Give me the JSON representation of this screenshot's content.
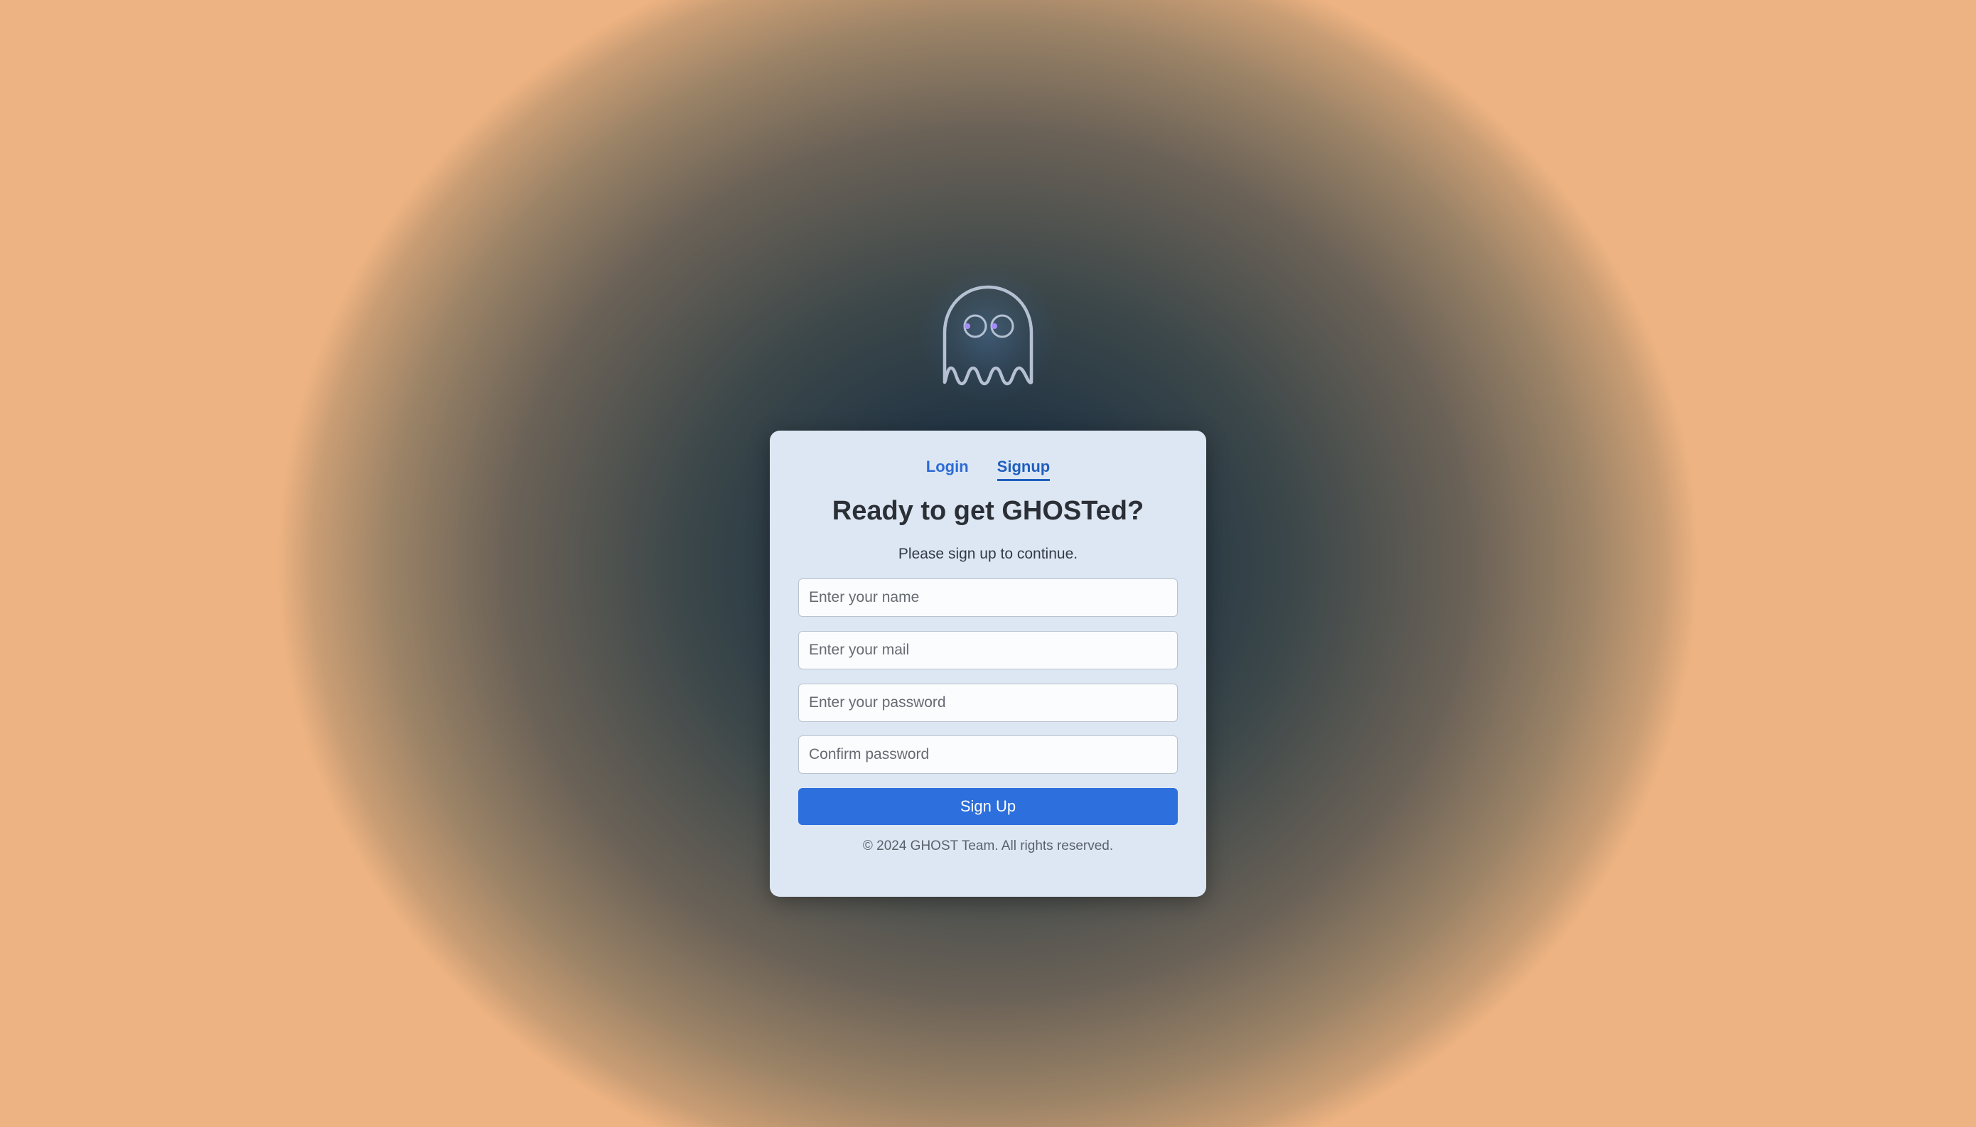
{
  "logo": {
    "icon": "ghost-icon"
  },
  "tabs": [
    {
      "label": "Login",
      "active": false
    },
    {
      "label": "Signup",
      "active": true
    }
  ],
  "form": {
    "title": "Ready to get GHOSTed?",
    "subtitle": "Please sign up to continue.",
    "fields": {
      "name": {
        "value": "",
        "placeholder": "Enter your name"
      },
      "mail": {
        "value": "",
        "placeholder": "Enter your mail"
      },
      "password": {
        "value": "",
        "placeholder": "Enter your password"
      },
      "confirm": {
        "value": "",
        "placeholder": "Confirm password"
      }
    },
    "submit_label": "Sign Up"
  },
  "footer": "© 2024 GHOST Team. All rights reserved.",
  "colors": {
    "accent": "#2d6fdc",
    "card_bg": "#dde7f3",
    "ghost_eye": "#a78bfa"
  }
}
